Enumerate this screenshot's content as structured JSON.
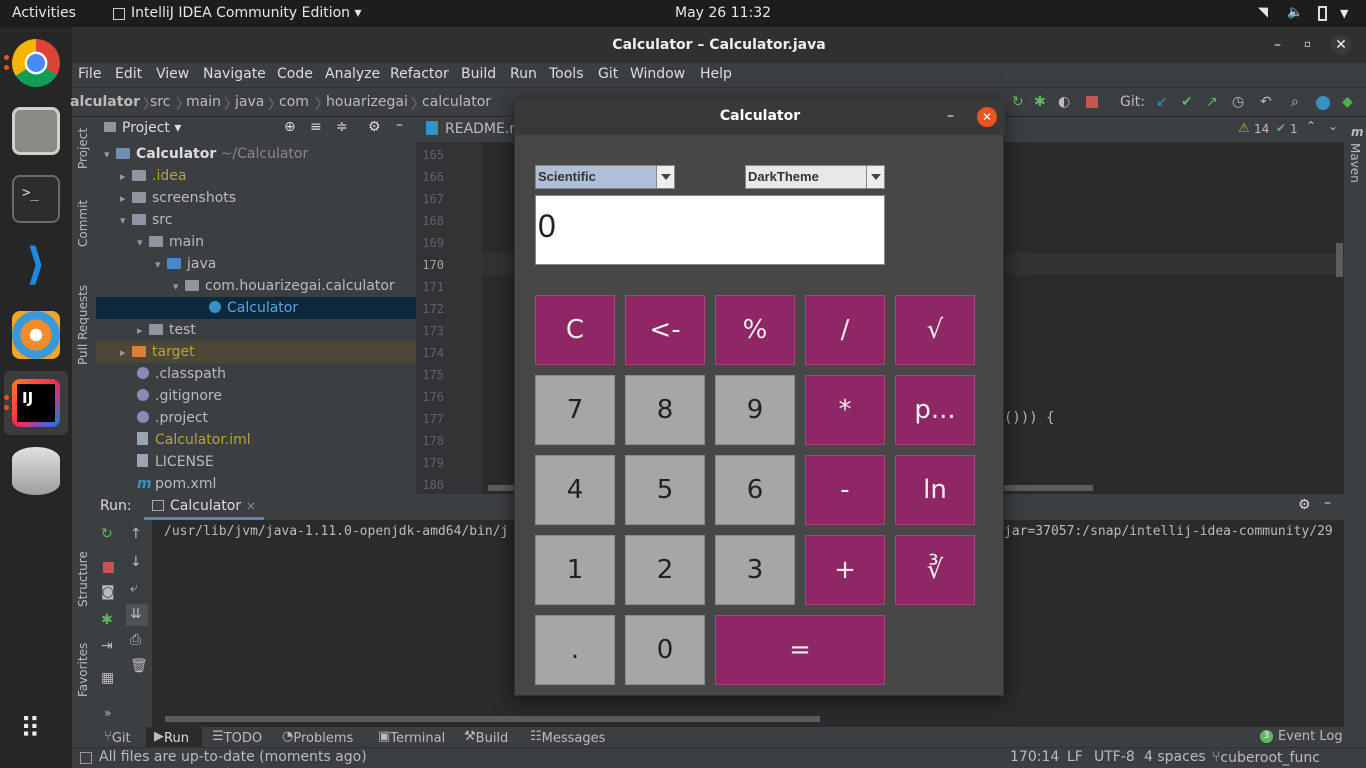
{
  "topbar": {
    "activities": "Activities",
    "app_menu": "IntelliJ IDEA Community Edition ▾",
    "clock": "May 26  11:32"
  },
  "window": {
    "title": "Calculator – Calculator.java"
  },
  "menu": [
    "File",
    "Edit",
    "View",
    "Navigate",
    "Code",
    "Analyze",
    "Refactor",
    "Build",
    "Run",
    "Tools",
    "Git",
    "Window",
    "Help"
  ],
  "breadcrumb": [
    "alculator",
    "src",
    "main",
    "java",
    "com",
    "houarizegai",
    "calculator"
  ],
  "nav_git_label": "Git:",
  "sidebar": {
    "project": "Project",
    "commit": "Commit",
    "pull_requests": "Pull Requests",
    "structure": "Structure",
    "favorites": "Favorites",
    "maven": "Maven"
  },
  "project_panel": {
    "title": "Project ▾",
    "root": {
      "name": "Calculator",
      "path": "~/Calculator"
    },
    "items": [
      ".idea",
      "screenshots",
      "src",
      "main",
      "java",
      "com.houarizegai.calculator",
      "Calculator",
      "test",
      "target",
      ".classpath",
      ".gitignore",
      ".project",
      "Calculator.iml",
      "LICENSE",
      "pom.xml"
    ]
  },
  "editor": {
    "tab": "README.m",
    "lines": [
      "165",
      "166",
      "167",
      "168",
      "169",
      "170",
      "171",
      "172",
      "173",
      "174",
      "175",
      "176",
      "177",
      "178",
      "179",
      "180"
    ],
    "code_fragment": "())) {",
    "warnings": "14",
    "ok": "1"
  },
  "run_panel": {
    "label": "Run:",
    "tab": "Calculator",
    "output_left": "/usr/lib/jvm/java-1.11.0-openjdk-amd64/bin/j",
    "output_right": "jar=37057:/snap/intellij-idea-community/29"
  },
  "bottom_tabs": [
    "Git",
    "Run",
    "TODO",
    "Problems",
    "Terminal",
    "Build",
    "Messages"
  ],
  "event_log": {
    "count": "3",
    "label": "Event Log"
  },
  "status": {
    "message": "All files are up-to-date (moments ago)",
    "position": "170:14",
    "line_sep": "LF",
    "encoding": "UTF-8",
    "indent": "4 spaces",
    "branch": "cuberoot_func"
  },
  "calculator": {
    "title": "Calculator",
    "mode": "Scientific",
    "theme": "DarkTheme",
    "display": "0",
    "buttons": {
      "clear": "C",
      "back": "<-",
      "percent": "%",
      "divide": "/",
      "sqrt": "√",
      "seven": "7",
      "eight": "8",
      "nine": "9",
      "multiply": "*",
      "power": "p...",
      "four": "4",
      "five": "5",
      "six": "6",
      "minus": "-",
      "ln": "ln",
      "one": "1",
      "two": "2",
      "three": "3",
      "plus": "+",
      "cbrt": "∛",
      "dot": ".",
      "zero": "0",
      "equals": "="
    }
  }
}
